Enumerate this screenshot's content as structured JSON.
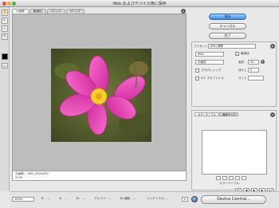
{
  "window": {
    "title": "Web およびデバイス用に保存"
  },
  "tabs": [
    "元画像",
    "最適化",
    "2アップ",
    "4アップ"
  ],
  "actions": {
    "save": "保存",
    "cancel": "キャンセル",
    "done": "完了"
  },
  "settings": {
    "preset_label": "プリセット：",
    "preset_value": "JPEG 標準",
    "format": "JPEG",
    "quality_level": "中画質",
    "optimize_label": "最適化",
    "quality_label": "画質",
    "quality_value": "30",
    "progressive_label": "プログレッシブ",
    "blur_label": "ぼかし",
    "blur_value": "0",
    "icc_label": "ICC プロファイル",
    "matte_label": "マット"
  },
  "color_table": {
    "tabs": [
      "カラーテーブル",
      "画像サイズ"
    ],
    "count_label": "カラーテーブル"
  },
  "image_info": {
    "name_label": "元画像：\"IMG_0226.JPG\"",
    "size": "237K"
  },
  "status": {
    "zoom": "100%",
    "r": "R：",
    "r_val": "--",
    "g": "G：",
    "g_val": "--",
    "b": "B：",
    "b_val": "--",
    "alpha": "アルファ：",
    "alpha_val": "--",
    "hex": "16 進数：",
    "hex_val": "--",
    "index": "インデックス：",
    "index_val": "--",
    "device_central": "Device Central..."
  }
}
